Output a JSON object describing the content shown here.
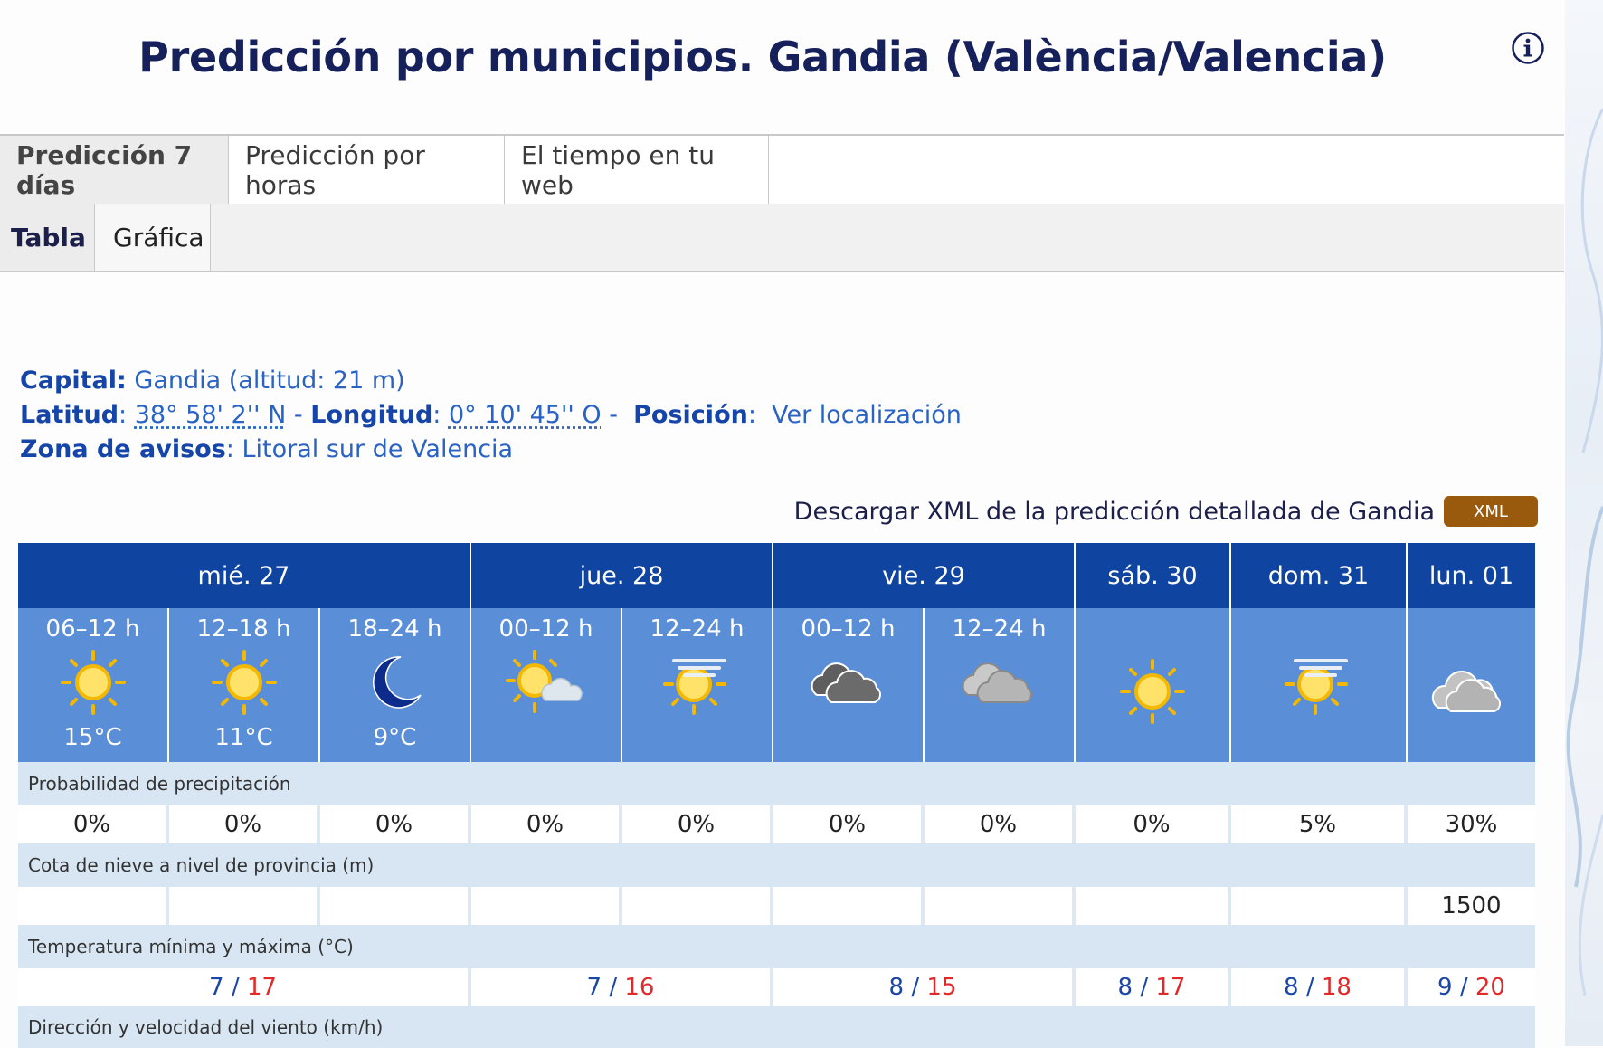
{
  "page": {
    "title": "Predicción por municipios. Gandia (València/Valencia)"
  },
  "tabs": [
    "Predicción 7 días",
    "Predicción por horas",
    "El tiempo en tu web"
  ],
  "subtabs": [
    "Tabla",
    "Gráfica"
  ],
  "info": {
    "capital_key": "Capital:",
    "capital_val": "Gandia (altitud: 21 m)",
    "lat_key": "Latitud",
    "lat_val": "38° 58' 2'' N",
    "lon_key": "Longitud",
    "lon_val": "0° 10' 45'' O",
    "pos_key": "Posición",
    "pos_val": "Ver localización",
    "zona_key": "Zona de avisos",
    "zona_val": "Litoral sur de Valencia"
  },
  "xml": {
    "text": "Descargar XML de la predicción detallada de Gandia",
    "button": "XML"
  },
  "days": [
    {
      "label": "mié. 27"
    },
    {
      "label": "jue. 28"
    },
    {
      "label": "vie. 29"
    },
    {
      "label": "sáb. 30"
    },
    {
      "label": "dom. 31"
    },
    {
      "label": "lun. 01"
    }
  ],
  "periods": [
    {
      "hours": "06–12 h",
      "icon": "sun-icon",
      "temp": "15°C"
    },
    {
      "hours": "12–18 h",
      "icon": "sun-icon",
      "temp": "11°C"
    },
    {
      "hours": "18–24 h",
      "icon": "moon-icon",
      "temp": "9°C"
    },
    {
      "hours": "00–12 h",
      "icon": "sun-cloud-icon",
      "temp": ""
    },
    {
      "hours": "12–24 h",
      "icon": "sun-haze-icon",
      "temp": ""
    },
    {
      "hours": "00–12 h",
      "icon": "dark-cloud-icon",
      "temp": ""
    },
    {
      "hours": "12–24 h",
      "icon": "cloud-icon",
      "temp": ""
    },
    {
      "hours": "",
      "icon": "sun-icon",
      "temp": ""
    },
    {
      "hours": "",
      "icon": "sun-haze-icon",
      "temp": ""
    },
    {
      "hours": "",
      "icon": "cloud-icon",
      "temp": ""
    }
  ],
  "labels": {
    "precip": "Probabilidad de precipitación",
    "nieve": "Cota de nieve a nivel de provincia (m)",
    "temp": "Temperatura mínima y máxima (°C)",
    "viento": "Dirección y velocidad del viento (km/h)"
  },
  "precip": [
    "0%",
    "0%",
    "0%",
    "0%",
    "0%",
    "0%",
    "0%",
    "0%",
    "5%",
    "30%"
  ],
  "nieve": [
    "",
    "",
    "",
    "",
    "",
    "",
    "",
    "",
    "",
    "1500"
  ],
  "temps": [
    {
      "min": "7",
      "max": "17"
    },
    {
      "min": "7",
      "max": "16"
    },
    {
      "min": "8",
      "max": "15"
    },
    {
      "min": "8",
      "max": "17"
    },
    {
      "min": "8",
      "max": "18"
    },
    {
      "min": "9",
      "max": "20"
    }
  ],
  "colors": {
    "day_header": "#0f44a0",
    "period_bg": "#5a8fd8",
    "label_bg": "#d7e6f2",
    "max_temp": "#e02a2a",
    "min_temp": "#1a47a3"
  }
}
